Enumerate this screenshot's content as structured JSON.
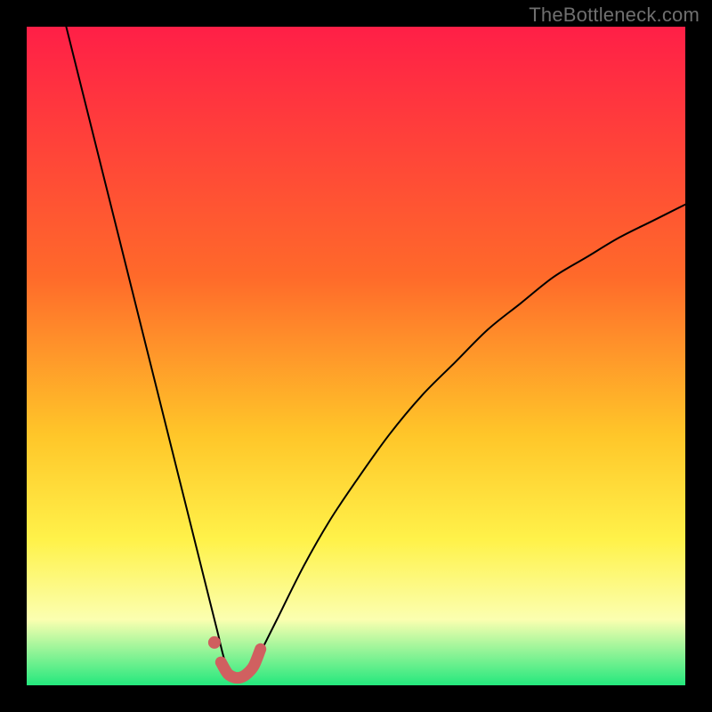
{
  "watermark": "TheBottleneck.com",
  "colors": {
    "bg": "#000000",
    "grad_top": "#ff1f47",
    "grad_mid1": "#ff6a2a",
    "grad_mid2": "#ffc629",
    "grad_mid3": "#fff24a",
    "grad_mid4": "#fbffb0",
    "grad_bot": "#24e87d",
    "curve_stroke": "#000000",
    "marker_stroke": "#d06060",
    "marker_fill": "#cf5f5f"
  },
  "chart_data": {
    "type": "line",
    "title": "",
    "xlabel": "",
    "ylabel": "",
    "xlim": [
      0,
      100
    ],
    "ylim": [
      0,
      100
    ],
    "series": [
      {
        "name": "bottleneck-curve",
        "x": [
          6,
          8,
          10,
          12,
          14,
          16,
          18,
          20,
          22,
          24,
          26,
          28,
          29,
          30,
          31,
          32,
          33,
          34,
          35,
          36,
          38,
          42,
          46,
          50,
          55,
          60,
          65,
          70,
          75,
          80,
          85,
          90,
          95,
          100
        ],
        "values": [
          100,
          92,
          84,
          76,
          68,
          60,
          52,
          44,
          36,
          28,
          20,
          12,
          8,
          4,
          2,
          1,
          1,
          2,
          4,
          6,
          10,
          18,
          25,
          31,
          38,
          44,
          49,
          54,
          58,
          62,
          65,
          68,
          70.5,
          73
        ]
      }
    ],
    "markers": {
      "name": "highlight-band",
      "x": [
        28.5,
        29.5,
        30.5,
        31.5,
        32.5,
        33.5,
        34.5,
        35.5
      ],
      "values": [
        6.5,
        3.5,
        1.8,
        1.2,
        1.2,
        1.8,
        3.0,
        5.5
      ]
    }
  }
}
